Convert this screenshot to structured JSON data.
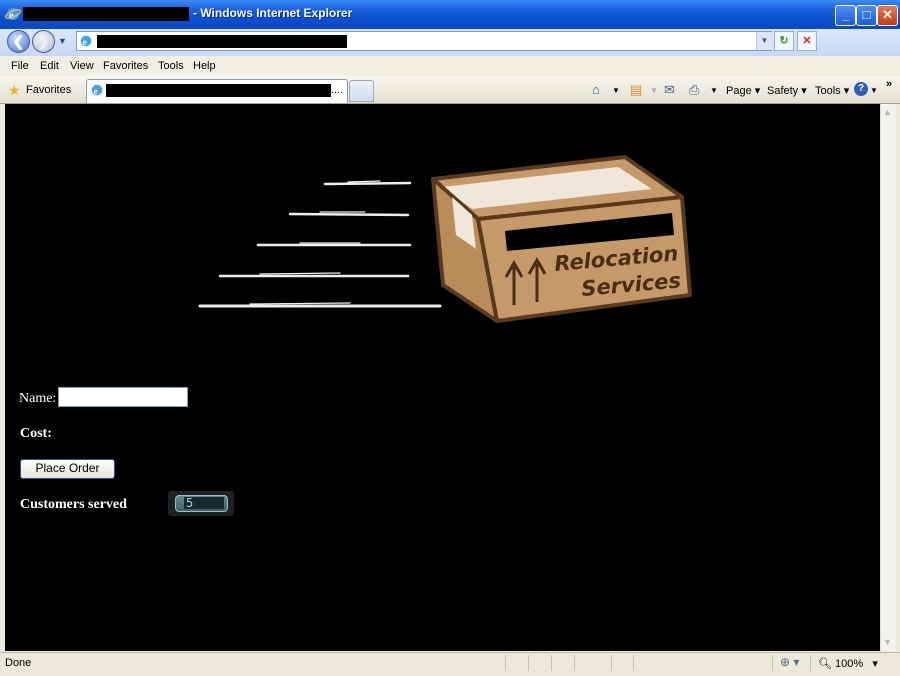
{
  "window": {
    "title_suffix": "- Windows Internet Explorer",
    "caption_buttons": {
      "minimize": "_",
      "maximize": "□",
      "close": "✕"
    }
  },
  "address_bar": {
    "url": ""
  },
  "menu": [
    "File",
    "Edit",
    "View",
    "Favorites",
    "Tools",
    "Help"
  ],
  "tabs": {
    "favorites_label": "Favorites",
    "active_tab_ellipsis": "...."
  },
  "command_bar": {
    "page_label": "Page",
    "safety_label": "Safety",
    "tools_label": "Tools",
    "more": "»"
  },
  "page": {
    "logo_text_line1": "Relocation",
    "logo_text_line2": "Services",
    "name_label": "Name:",
    "name_value": "",
    "cost_label": "Cost:",
    "place_order_label": "Place Order",
    "customers_served_label": "Customers served",
    "customers_served_count": "5"
  },
  "status_bar": {
    "status_text": "Done",
    "zoom": "100%"
  },
  "colors": {
    "page_background": "#000000",
    "box_cardboard": "#c69a68",
    "box_outline": "#5a3a1c"
  },
  "icons": [
    "ie-logo-icon",
    "back-arrow-icon",
    "forward-arrow-icon",
    "refresh-icon",
    "stop-icon",
    "star-icon",
    "home-icon",
    "rss-icon",
    "mail-icon",
    "print-icon",
    "help-icon",
    "globe-zone-icon",
    "zoom-icon"
  ]
}
